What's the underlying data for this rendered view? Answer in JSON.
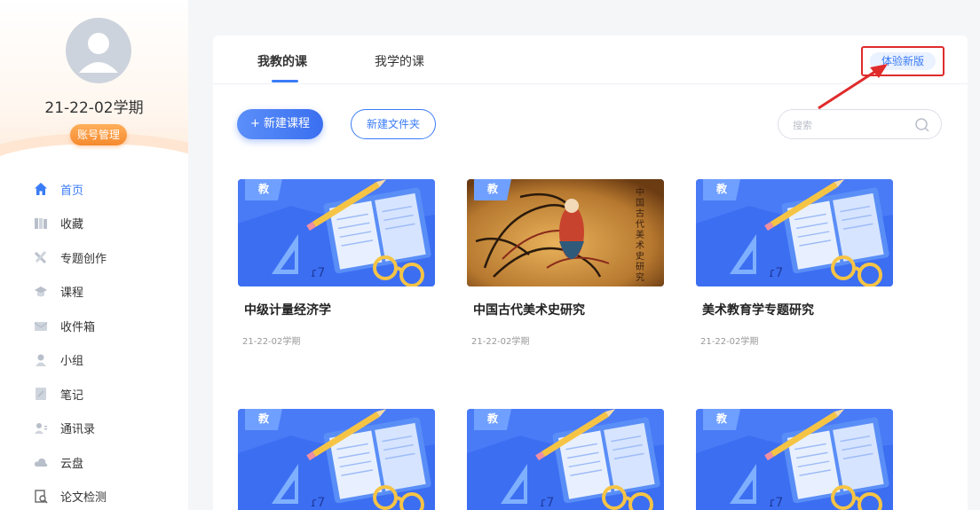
{
  "profile": {
    "term": "21-22-02学期",
    "account_button": "账号管理"
  },
  "nav": [
    {
      "label": "首页",
      "icon": "home-icon",
      "active": true
    },
    {
      "label": "收藏",
      "icon": "bookmark-icon",
      "active": false
    },
    {
      "label": "专题创作",
      "icon": "tools-icon",
      "active": false
    },
    {
      "label": "课程",
      "icon": "course-icon",
      "active": false
    },
    {
      "label": "收件箱",
      "icon": "inbox-icon",
      "active": false
    },
    {
      "label": "小组",
      "icon": "group-icon",
      "active": false
    },
    {
      "label": "笔记",
      "icon": "note-icon",
      "active": false
    },
    {
      "label": "通讯录",
      "icon": "contacts-icon",
      "active": false
    },
    {
      "label": "云盘",
      "icon": "cloud-icon",
      "active": false
    },
    {
      "label": "论文检测",
      "icon": "paper-check-icon",
      "active": false
    }
  ],
  "tabs": [
    "我教的课",
    "我学的课"
  ],
  "try_new": "体验新版",
  "actions": {
    "new_course": "+ 新建课程",
    "new_folder": "新建文件夹"
  },
  "search": {
    "placeholder": "搜索"
  },
  "courses": [
    {
      "badge": "教",
      "title": "中级计量经济学",
      "term": "21-22-02学期",
      "cover": "default"
    },
    {
      "badge": "教",
      "title": "中国古代美术史研究",
      "term": "21-22-02学期",
      "cover": "art"
    },
    {
      "badge": "教",
      "title": "美术教育学专题研究",
      "term": "21-22-02学期",
      "cover": "default"
    },
    {
      "badge": "教",
      "title": "",
      "term": "",
      "cover": "default"
    },
    {
      "badge": "教",
      "title": "",
      "term": "",
      "cover": "default"
    },
    {
      "badge": "教",
      "title": "",
      "term": "",
      "cover": "default"
    }
  ],
  "colors": {
    "accent": "#3a7cf7",
    "highlight_box": "#e02b2b",
    "account_orange": "#f58a2e"
  }
}
